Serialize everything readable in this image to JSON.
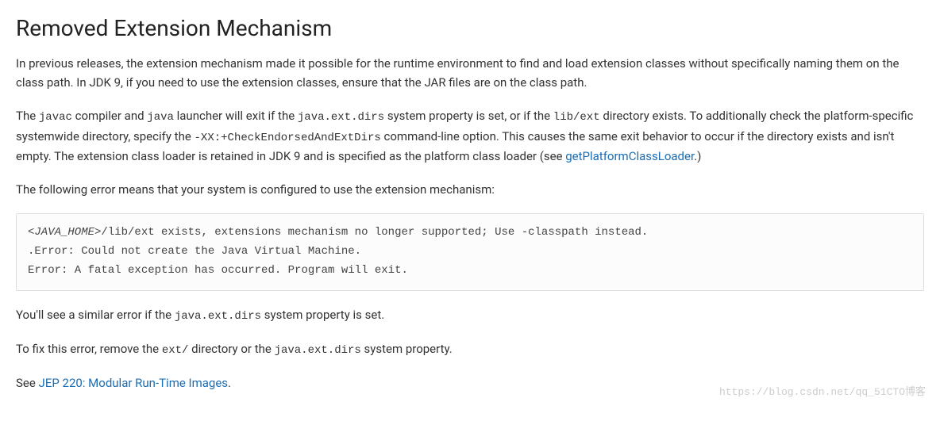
{
  "heading": "Removed Extension Mechanism",
  "para1": "In previous releases, the extension mechanism made it possible for the runtime environment to find and load extension classes without specifically naming them on the class path. In JDK 9, if you need to use the extension classes, ensure that the JAR files are on the class path.",
  "para2": {
    "t1": "The ",
    "c1": "javac",
    "t2": " compiler and ",
    "c2": "java",
    "t3": " launcher will exit if the ",
    "c3": "java.ext.dirs",
    "t4": " system property is set, or if the ",
    "c4": "lib/ext",
    "t5": " directory exists. To additionally check the platform-specific systemwide directory, specify the ",
    "c5": "-XX:+CheckEndorsedAndExtDirs",
    "t6": " command-line option. This causes the same exit behavior to occur if the directory exists and isn't empty. The extension class loader is retained in JDK 9 and is specified as the platform class loader (see ",
    "link": "getPlatformClassLoader",
    "t7": ".)"
  },
  "para3": "The following error means that your system is configured to use the extension mechanism:",
  "codeblock": {
    "l1a": "<JAVA_HOME>",
    "l1b": "/lib/ext exists, extensions mechanism no longer supported; Use -classpath instead.",
    "l2": ".Error: Could not create the Java Virtual Machine.",
    "l3": "Error: A fatal exception has occurred. Program will exit."
  },
  "para4": {
    "t1": "You'll see a similar error if the ",
    "c1": "java.ext.dirs",
    "t2": " system property is set."
  },
  "para5": {
    "t1": "To fix this error, remove the ",
    "c1": "ext/",
    "t2": " directory or the ",
    "c2": "java.ext.dirs",
    "t3": " system property."
  },
  "para6": {
    "t1": "See ",
    "link": "JEP 220: Modular Run-Time Images",
    "t2": "."
  },
  "watermark": "https://blog.csdn.net/qq_51CTO博客"
}
